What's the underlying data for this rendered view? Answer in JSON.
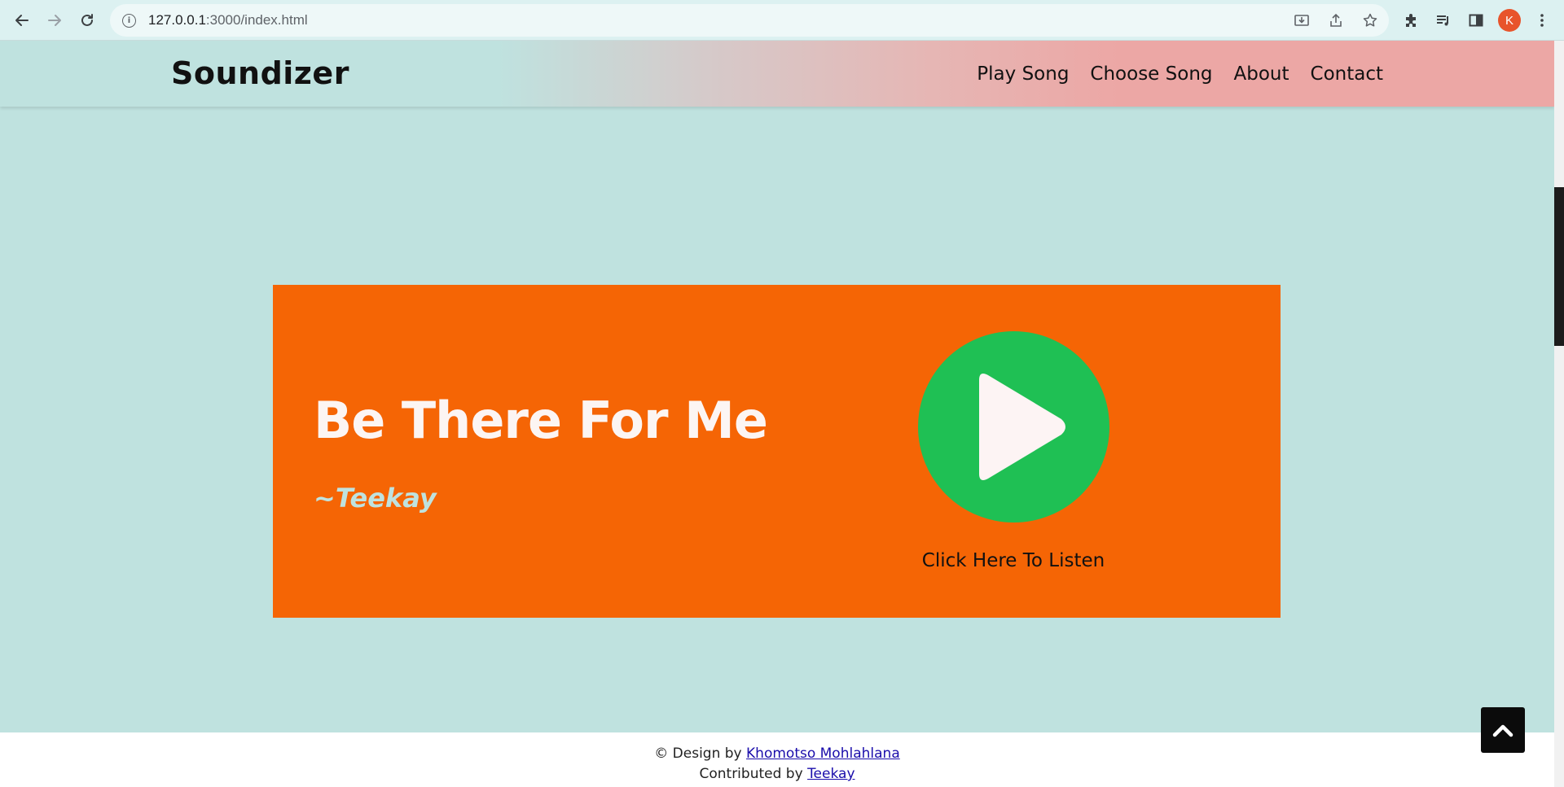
{
  "browser": {
    "url_host": "127.0.0.1",
    "url_path": ":3000/index.html",
    "info_icon": "i",
    "profile_initial": "K"
  },
  "header": {
    "brand": "Soundizer",
    "nav": [
      {
        "label": "Play Song"
      },
      {
        "label": "Choose Song"
      },
      {
        "label": "About"
      },
      {
        "label": "Contact"
      }
    ]
  },
  "card": {
    "song_title": "Be There For Me",
    "artist": "~Teekay",
    "listen_label": "Click Here To Listen"
  },
  "footer": {
    "design_prefix": "© Design by",
    "designer": "Khomotso Mohlahlana",
    "contrib_prefix": "Contributed by",
    "contributor": "Teekay"
  },
  "colors": {
    "page_bg": "#bfe2df",
    "card_bg": "#f56505",
    "play_green": "#1fc054",
    "header_pink": "#eca7a5"
  },
  "icons": {
    "back": "arrow-left-icon",
    "forward": "arrow-right-icon",
    "reload": "reload-icon",
    "install": "install-icon",
    "share": "share-icon",
    "bookmark": "star-icon",
    "extensions": "puzzle-icon",
    "media": "media-queue-icon",
    "side_panel": "side-panel-icon",
    "menu": "kebab-menu-icon",
    "play": "play-icon",
    "scroll_top": "chevron-up-icon"
  }
}
